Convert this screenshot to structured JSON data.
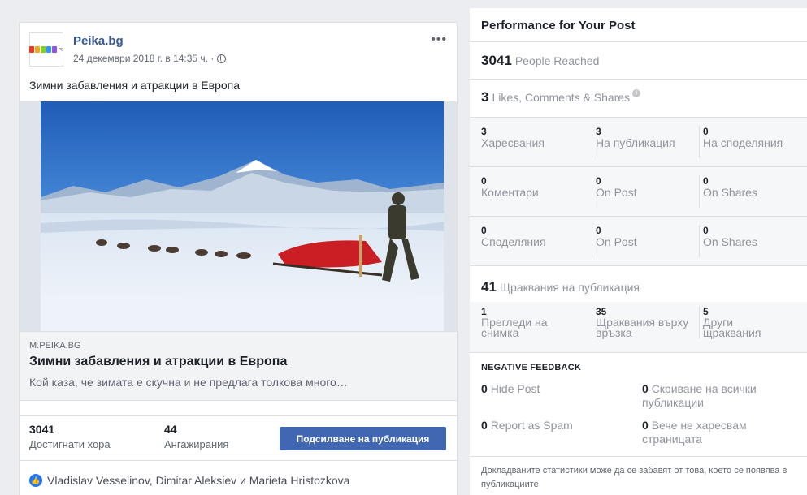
{
  "post": {
    "page_name": "Peika.bg",
    "timestamp": "24 декември 2018 г. в 14:35 ч. ·",
    "more_icon": "more-horizontal-icon",
    "text": "Зимни забавления и атракции в Европа",
    "link": {
      "domain": "M.PEIKA.BG",
      "title": "Зимни забавления и атракции в Европа",
      "description": "Кой каза, че зимата е скучна и не предлага толкова много…"
    },
    "stats": {
      "reached_value": "3041",
      "reached_label": "Достигнати хора",
      "engagement_value": "44",
      "engagement_label": "Ангажирания"
    },
    "boost_label": "Подсилване на публикация",
    "likers": "Vladislav Vesselinov, Dimitar Aleksiev и Marieta Hristozkova"
  },
  "performance": {
    "title": "Performance for Your Post",
    "people_reached_value": "3041",
    "people_reached_label": "People Reached",
    "lcs_value": "3",
    "lcs_label": "Likes, Comments & Shares",
    "rows": [
      {
        "c1v": "3",
        "c1l": "Харесвания",
        "c2v": "3",
        "c2l": "На публикация",
        "c3v": "0",
        "c3l": "На споделяния"
      },
      {
        "c1v": "0",
        "c1l": "Коментари",
        "c2v": "0",
        "c2l": "On Post",
        "c3v": "0",
        "c3l": "On Shares"
      },
      {
        "c1v": "0",
        "c1l": "Споделяния",
        "c2v": "0",
        "c2l": "On Post",
        "c3v": "0",
        "c3l": "On Shares"
      }
    ],
    "clicks_value": "41",
    "clicks_label": "Щраквания на публикация",
    "clicks": [
      {
        "value": "1",
        "label": "Прегледи на снимка"
      },
      {
        "value": "35",
        "label": "Щраквания върху връзка"
      },
      {
        "value": "5",
        "label": "Други щраквания"
      }
    ],
    "negative": {
      "title": "NEGATIVE FEEDBACK",
      "hide_post_value": "0",
      "hide_post_label": "Hide Post",
      "hide_all_value": "0",
      "hide_all_label": "Скриване на всички публикации",
      "spam_value": "0",
      "spam_label": "Report as Spam",
      "unlike_value": "0",
      "unlike_label": "Вече не харесвам страницата"
    },
    "footnote": "Докладваните статистики може да се забавят от това, което се появява в публикациите"
  },
  "colors": {
    "link_blue": "#365899",
    "button_blue": "#4267b2",
    "muted": "#90949c"
  }
}
